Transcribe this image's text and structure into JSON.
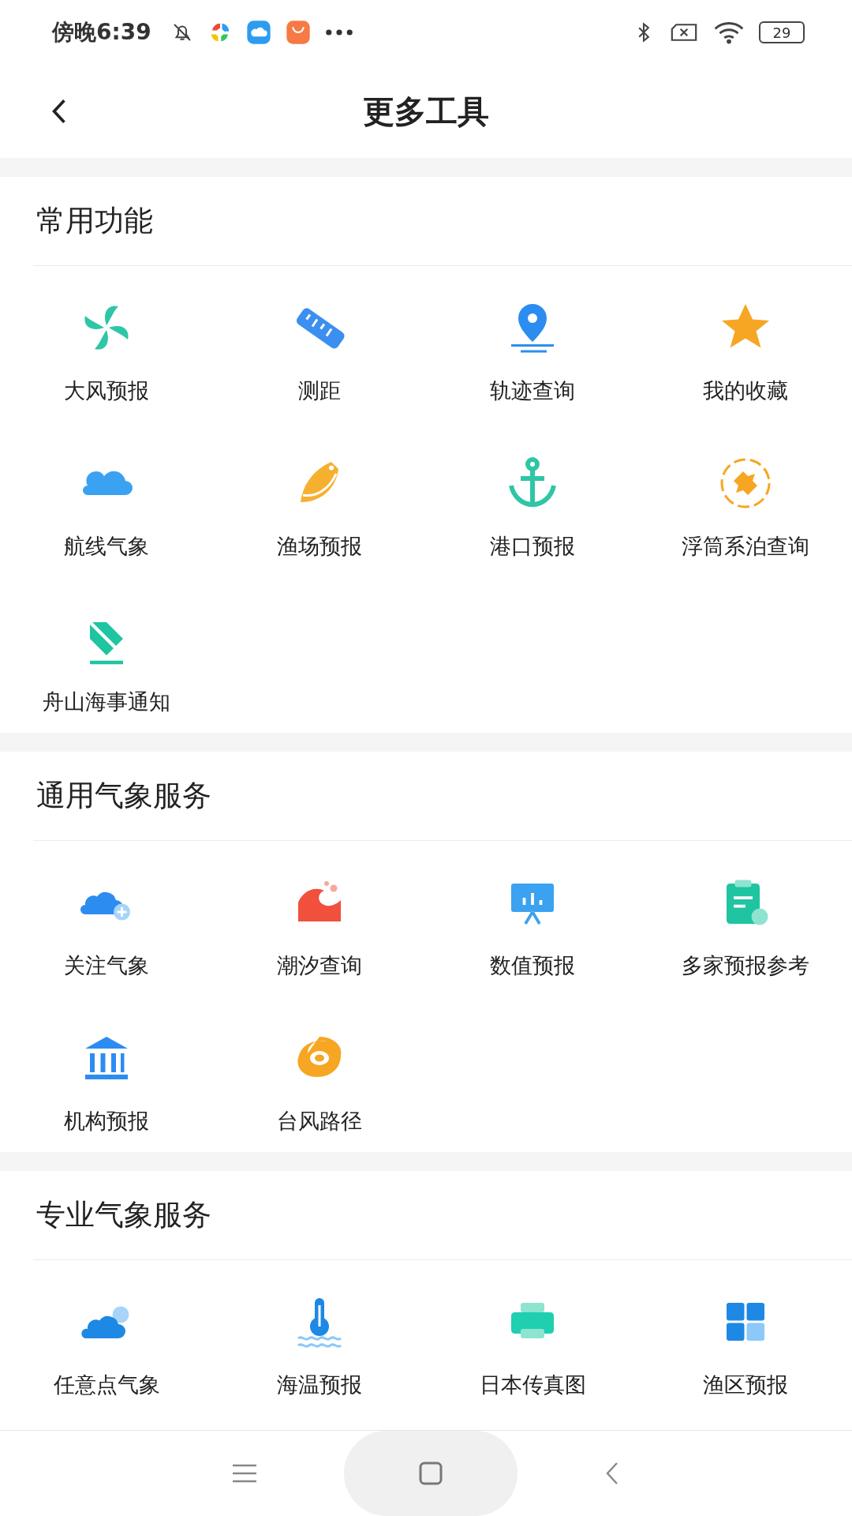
{
  "status_bar": {
    "time": "傍晚6:39",
    "battery": "29"
  },
  "header": {
    "title": "更多工具"
  },
  "sections": [
    {
      "title": "常用功能",
      "items": [
        "大风预报",
        "测距",
        "轨迹查询",
        "我的收藏",
        "航线气象",
        "渔场预报",
        "港口预报",
        "浮筒系泊查询",
        "舟山海事通知"
      ]
    },
    {
      "title": "通用气象服务",
      "items": [
        "关注气象",
        "潮汐查询",
        "数值预报",
        "多家预报参考",
        "机构预报",
        "台风路径"
      ]
    },
    {
      "title": "专业气象服务",
      "items": [
        "任意点气象",
        "海温预报",
        "日本传真图",
        "渔区预报"
      ]
    }
  ]
}
